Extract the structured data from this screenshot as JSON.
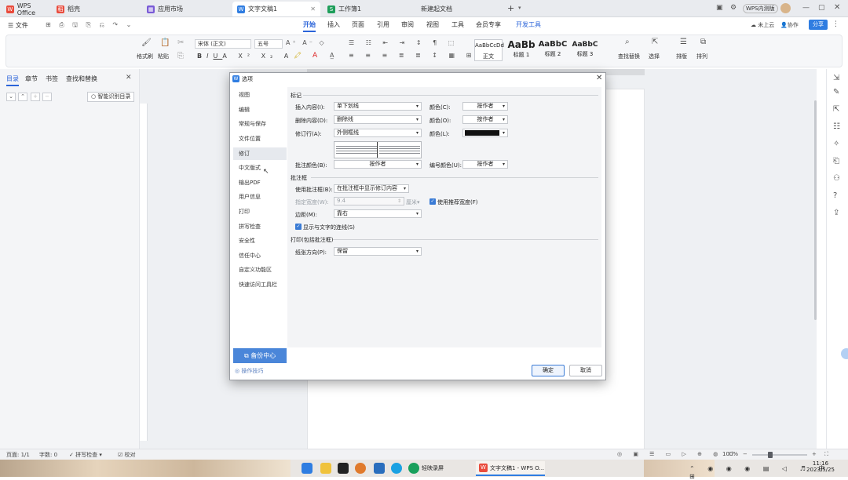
{
  "tabbar": {
    "tabs": [
      {
        "label": "WPS Office",
        "color": "#e94b3c"
      },
      {
        "label": "稻壳",
        "color": "#e94b3c"
      },
      {
        "label": "应用市场",
        "color": "#7a5bd6"
      },
      {
        "label": "文字文稿1",
        "color": "#2f7de1"
      },
      {
        "label": "工作簿1",
        "color": "#1e9e5a"
      },
      {
        "label": "新建起文档",
        "color": "#888888"
      }
    ],
    "add_label": "+",
    "account_label": "WPS内测版"
  },
  "menubar": {
    "file_label": "文件",
    "tabs": [
      "开始",
      "插入",
      "页面",
      "引用",
      "审阅",
      "视图",
      "工具",
      "会员专享"
    ],
    "special_tab": "开发工具",
    "upload_label": "未上云",
    "collab_label": "协作",
    "share_label": "分享"
  },
  "ribbon": {
    "format_painter": "格式刷",
    "paste": "粘贴",
    "font_name": "宋体 (正文)",
    "font_size": "五号",
    "styles": [
      {
        "preview": "AaBbCcDd",
        "name": "正文"
      },
      {
        "preview": "AaBb",
        "name": "标题 1"
      },
      {
        "preview": "AaBbC",
        "name": "标题 2"
      },
      {
        "preview": "AaBbC",
        "name": "标题 3"
      }
    ],
    "find_replace": "查找替换",
    "select": "选择",
    "arrange": "排版",
    "sort": "排列"
  },
  "navpane": {
    "tabs": [
      "目录",
      "章节",
      "书签",
      "查找和替换"
    ],
    "smart_toc": "智能识别目录"
  },
  "dialog": {
    "title": "选项",
    "sidebar": [
      "视图",
      "编辑",
      "常规与保存",
      "文件位置",
      "修订",
      "中文版式",
      "输出PDF",
      "用户信息",
      "打印",
      "拼写检查",
      "安全性",
      "信任中心",
      "自定义功能区",
      "快速访问工具栏"
    ],
    "selected_item": "修订",
    "backup_label": "备份中心",
    "tips_label": "操作技巧",
    "sections": {
      "markup": "标记",
      "balloons": "批注框",
      "print": "打印(包括批注框)"
    },
    "fields": {
      "insert_label": "插入内容(I):",
      "insert_value": "单下划线",
      "insert_color_label": "颜色(C):",
      "insert_color_value": "按作者",
      "delete_label": "删除内容(D):",
      "delete_value": "删除线",
      "delete_color_label": "颜色(O):",
      "delete_color_value": "按作者",
      "revline_label": "修订行(A):",
      "revline_value": "外侧框线",
      "revline_color_label": "颜色(L):",
      "comment_color_label": "批注颜色(B):",
      "comment_color_value": "按作者",
      "number_color_label": "编号颜色(U):",
      "number_color_value": "按作者",
      "use_balloons_label": "使用批注框(B):",
      "use_balloons_value": "在批注框中显示修订内容",
      "width_label": "指定宽度(W):",
      "width_value": "9.4",
      "width_unit": "厘米",
      "recommend_width": "使用推荐宽度(F)",
      "margin_label": "边距(M):",
      "margin_value": "靠右",
      "show_lines": "显示与文字的连线(S)",
      "paper_label": "纸张方向(P):",
      "paper_value": "保留"
    },
    "ok": "确定",
    "cancel": "取消"
  },
  "statusbar": {
    "page": "页面: 1/1",
    "words": "字数: 0",
    "spell": "拼写检查",
    "proof": "校对",
    "zoom": "100%"
  },
  "taskbar": {
    "recorder": "轻映录屏",
    "wps": "文字文稿1 - WPS O...",
    "time": "11:16",
    "date": "2023/5/25"
  }
}
